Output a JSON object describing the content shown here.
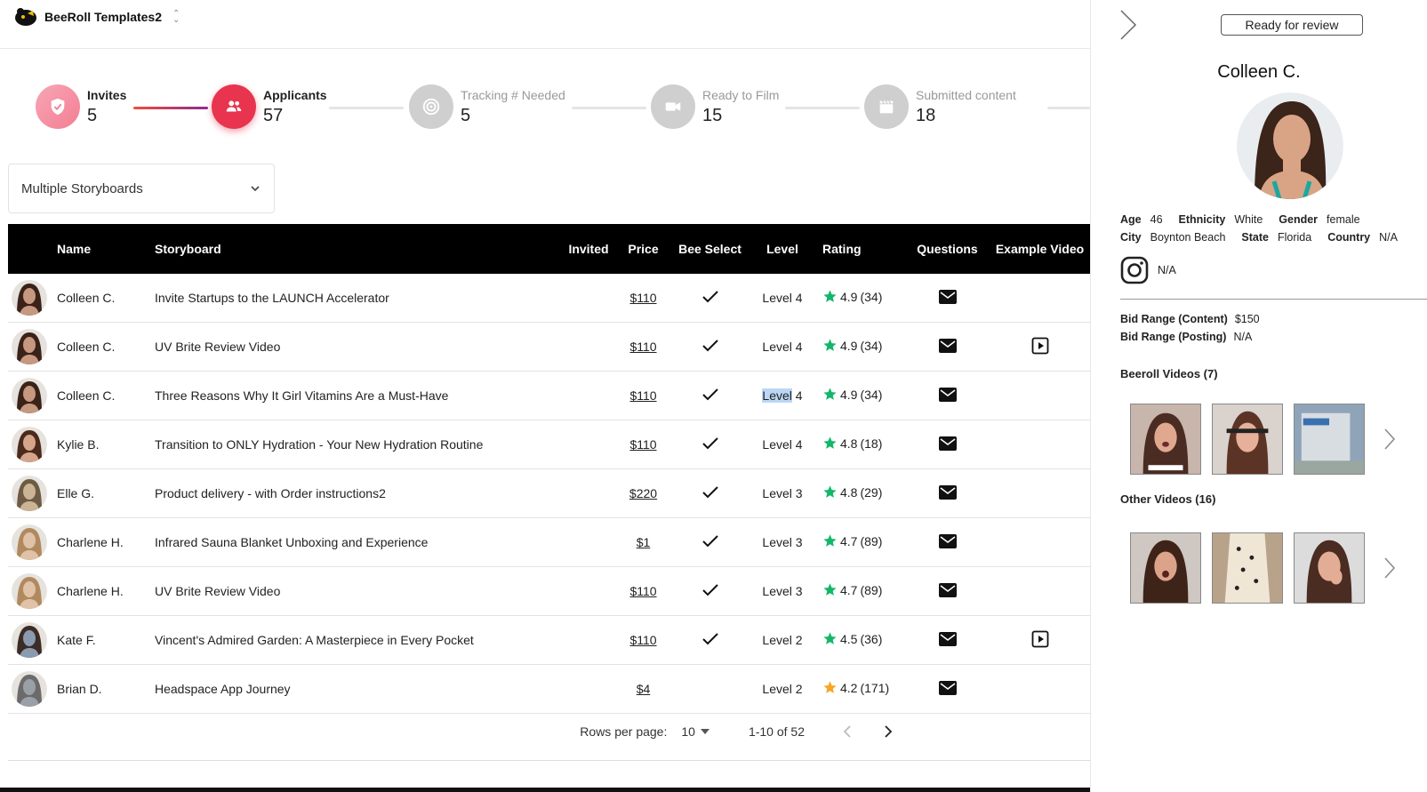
{
  "workspace": {
    "name": "BeeRoll Templates2"
  },
  "stepper": {
    "steps": [
      {
        "label": "Invites",
        "count": "5"
      },
      {
        "label": "Applicants",
        "count": "57"
      },
      {
        "label": "Tracking # Needed",
        "count": "5"
      },
      {
        "label": "Ready to Film",
        "count": "15"
      },
      {
        "label": "Submitted content",
        "count": "18"
      }
    ],
    "active_index": 1
  },
  "storyboard_select": {
    "value": "Multiple Storyboards"
  },
  "table": {
    "columns": [
      "Name",
      "Storyboard",
      "Invited",
      "Price",
      "Bee Select",
      "Level",
      "Rating",
      "Questions",
      "Example Video"
    ],
    "rows": [
      {
        "name": "Colleen C.",
        "storyboard": "Invite Startups to the LAUNCH Accelerator",
        "price": "$110",
        "bee_select": true,
        "level": "Level 4",
        "rating": "4.9",
        "reviews": "(34)",
        "star": "green",
        "example_video": false
      },
      {
        "name": "Colleen C.",
        "storyboard": "UV Brite Review Video",
        "price": "$110",
        "bee_select": true,
        "level": "Level 4",
        "rating": "4.9",
        "reviews": "(34)",
        "star": "green",
        "example_video": true
      },
      {
        "name": "Colleen C.",
        "storyboard": "Three Reasons Why It Girl Vitamins Are a Must-Have",
        "price": "$110",
        "bee_select": true,
        "level_word": "Level",
        "level_num": "4",
        "rating": "4.9",
        "reviews": "(34)",
        "star": "green",
        "example_video": false
      },
      {
        "name": "Kylie B.",
        "storyboard": "Transition to ONLY Hydration - Your New Hydration Routine",
        "price": "$110",
        "bee_select": true,
        "level": "Level 4",
        "rating": "4.8",
        "reviews": "(18)",
        "star": "green",
        "example_video": false
      },
      {
        "name": "Elle G.",
        "storyboard": "Product delivery - with Order instructions2",
        "price": "$220",
        "bee_select": true,
        "level": "Level 3",
        "rating": "4.8",
        "reviews": "(29)",
        "star": "green",
        "example_video": false
      },
      {
        "name": "Charlene H.",
        "storyboard": "Infrared Sauna Blanket Unboxing and Experience",
        "price": "$1",
        "bee_select": true,
        "level": "Level 3",
        "rating": "4.7",
        "reviews": "(89)",
        "star": "green",
        "example_video": false
      },
      {
        "name": "Charlene H.",
        "storyboard": "UV Brite Review Video",
        "price": "$110",
        "bee_select": true,
        "level": "Level 3",
        "rating": "4.7",
        "reviews": "(89)",
        "star": "green",
        "example_video": false
      },
      {
        "name": "Kate F.",
        "storyboard": "Vincent's Admired Garden: A Masterpiece in Every Pocket",
        "price": "$110",
        "bee_select": true,
        "level": "Level 2",
        "rating": "4.5",
        "reviews": "(36)",
        "star": "green",
        "example_video": true
      },
      {
        "name": "Brian D.",
        "storyboard": "Headspace App Journey",
        "price": "$4",
        "bee_select": false,
        "level": "Level 2",
        "rating": "4.2",
        "reviews": "(171)",
        "star": "orange",
        "example_video": false
      }
    ]
  },
  "pagination": {
    "rows_label": "Rows per page:",
    "rows_value": "10",
    "range": "1-10 of 52"
  },
  "panel": {
    "review_button": "Ready for review",
    "name": "Colleen C.",
    "age_label": "Age",
    "age": "46",
    "ethnicity_label": "Ethnicity",
    "ethnicity": "White",
    "gender_label": "Gender",
    "gender": "female",
    "city_label": "City",
    "city": "Boynton Beach",
    "state_label": "State",
    "state": "Florida",
    "country_label": "Country",
    "country": "N/A",
    "instagram": "N/A",
    "bid_content_label": "Bid Range (Content)",
    "bid_content": "$150",
    "bid_posting_label": "Bid Range (Posting)",
    "bid_posting": "N/A",
    "beeroll_videos": "Beeroll Videos (7)",
    "other_videos": "Other Videos (16)"
  },
  "colors": {
    "accent": "#e8344e",
    "star_green": "#12b76a",
    "star_orange": "#f5a623",
    "header_bg": "#000000"
  }
}
